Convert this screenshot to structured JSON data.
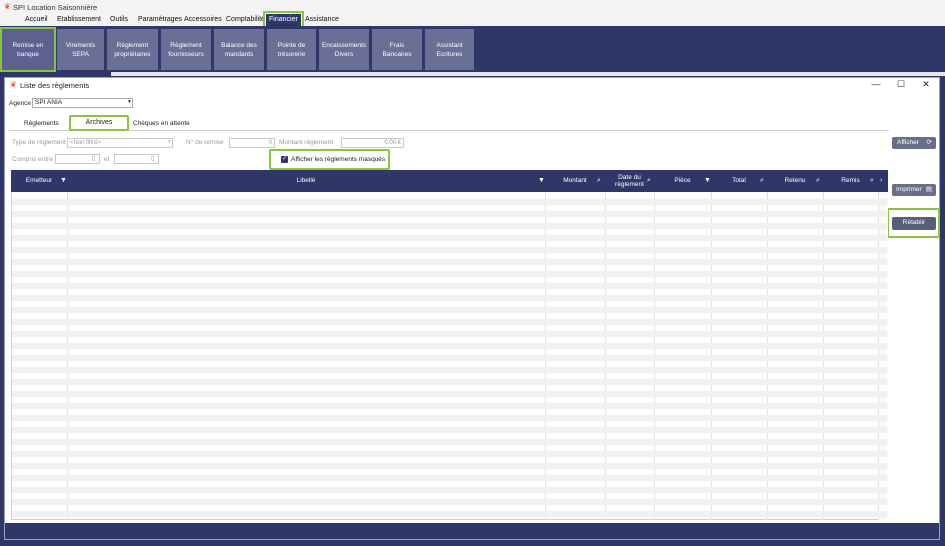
{
  "app": {
    "title": "SPI Location Saisonnière"
  },
  "menu": [
    "Accueil",
    "Etablissement",
    "Outils",
    "Paramétrages",
    "Accessoires",
    "Comptabilité",
    "Financier",
    "Assistance"
  ],
  "ribbon": [
    [
      "Remise en",
      "banque"
    ],
    [
      "Virements",
      "SEPA"
    ],
    [
      "Règlement",
      "propriétaires"
    ],
    [
      "Règlement",
      "fournisseurs"
    ],
    [
      "Balance des",
      "mandants"
    ],
    [
      "Pointe de",
      "trésorerie"
    ],
    [
      "Encaissements",
      "Divers"
    ],
    [
      "Frais",
      "Bancaires"
    ],
    [
      "Assistant",
      "Ecritures"
    ]
  ],
  "window": {
    "title": "Liste des règlements"
  },
  "agence": {
    "label": "Agence",
    "value": "SPI ANIA"
  },
  "tabs": [
    "Règlements",
    "Archives",
    "Chèques en attente"
  ],
  "filters": {
    "type_label": "Type de règlement",
    "type_value": "<Non filtré>",
    "remise_label": "N° de remise",
    "remise_value": "0",
    "montant_label": "Montant règlement",
    "montant_value": "0,00 €",
    "compris_label": "Compris entre",
    "et_label": "et",
    "checkbox_label": "Afficher les règlements masqués"
  },
  "buttons": {
    "afficher": "Afficher",
    "imprimer": "Imprimer",
    "retablir": "Rétablir"
  },
  "columns": [
    "Emetteur",
    "Libellé",
    "Montant",
    "Date du règlement",
    "Pièce",
    "Total",
    "Retenu",
    "Remis"
  ],
  "colors": {
    "navy": "#2f3769",
    "highlight": "#8bc53f",
    "ribbon_button": "#6a6f96"
  }
}
